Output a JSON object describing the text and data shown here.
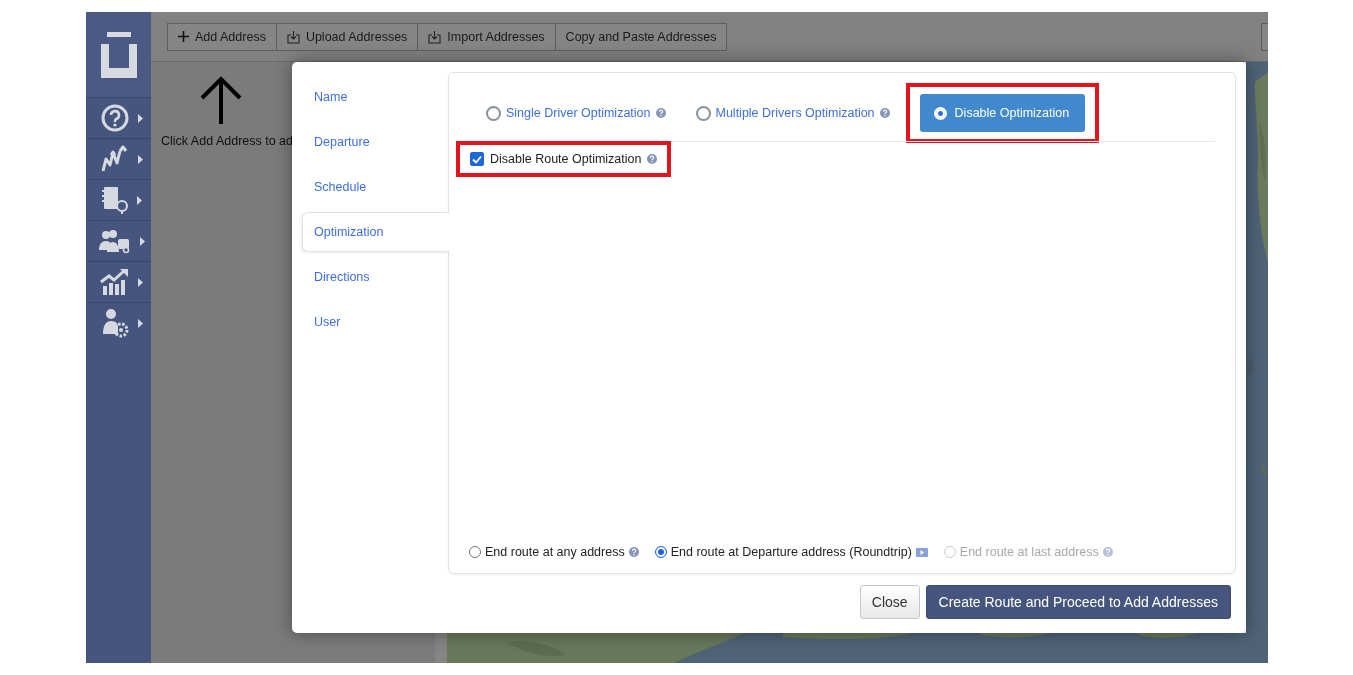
{
  "sidebar": {
    "items": [
      {
        "kind": "help"
      },
      {
        "kind": "routes"
      },
      {
        "kind": "addressbook"
      },
      {
        "kind": "team"
      },
      {
        "kind": "analytics"
      },
      {
        "kind": "settings"
      }
    ]
  },
  "toolbar": {
    "buttons": [
      {
        "label": "Add Address",
        "kind": "add"
      },
      {
        "label": "Upload Addresses",
        "kind": "upload"
      },
      {
        "label": "Import Addresses",
        "kind": "import"
      },
      {
        "label": "Copy and Paste Addresses",
        "kind": "paste"
      }
    ]
  },
  "left_panel": {
    "hint": "Click Add Address to ad"
  },
  "dialog": {
    "tabs": [
      {
        "label": "Name",
        "selected": false
      },
      {
        "label": "Departure",
        "selected": false
      },
      {
        "label": "Schedule",
        "selected": false
      },
      {
        "label": "Optimization",
        "selected": true
      },
      {
        "label": "Directions",
        "selected": false
      },
      {
        "label": "User",
        "selected": false
      }
    ],
    "optimization_modes": [
      {
        "label": "Single Driver Optimization",
        "selected": false,
        "highlighted": false
      },
      {
        "label": "Multiple Drivers Optimization",
        "selected": false,
        "highlighted": false
      },
      {
        "label": "Disable Optimization",
        "selected": true,
        "highlighted": true
      }
    ],
    "disable_route_optimization": {
      "label": "Disable Route Optimization",
      "checked": true,
      "highlighted": true
    },
    "end_route": [
      {
        "label": "End route at any address",
        "selected": false,
        "disabled": false,
        "kind": "any"
      },
      {
        "label": "End route at Departure address (Roundtrip)",
        "selected": true,
        "disabled": false,
        "kind": "roundtrip"
      },
      {
        "label": "End route at last address",
        "selected": false,
        "disabled": true,
        "kind": "last"
      }
    ],
    "buttons": [
      {
        "label": "Close",
        "kind": "secondary"
      },
      {
        "label": "Create Route and Proceed to Add Addresses",
        "kind": "primary"
      }
    ]
  }
}
